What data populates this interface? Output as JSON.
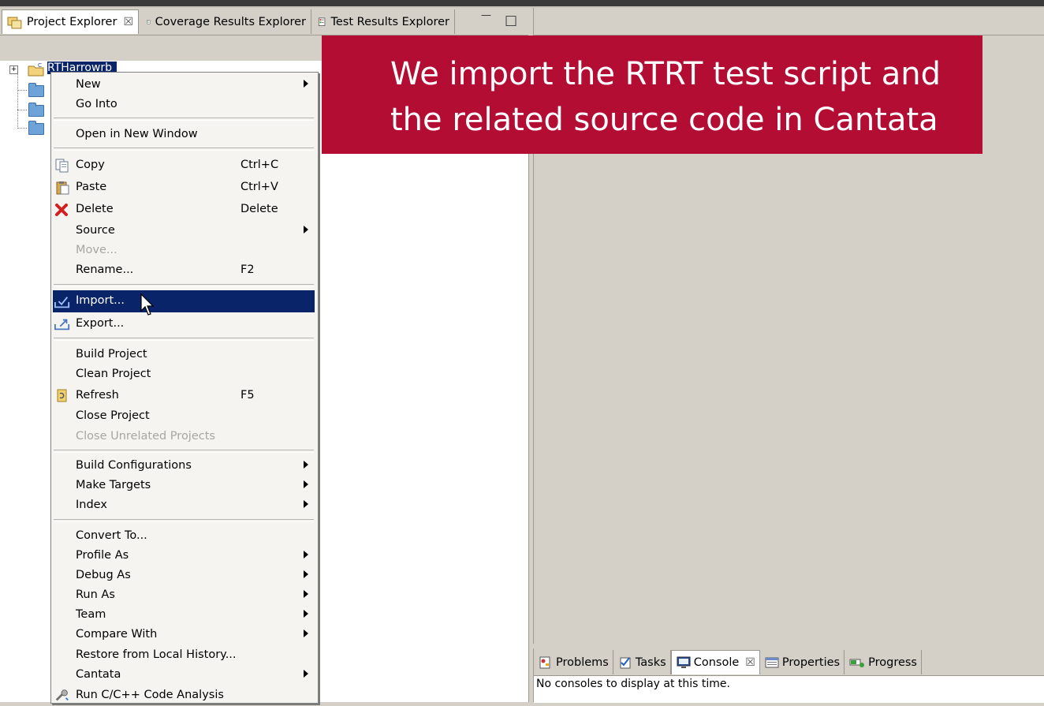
{
  "left_view": {
    "tabs": [
      {
        "label": "Project Explorer",
        "close": "☒",
        "icon": "project-explorer-icon",
        "active": true
      },
      {
        "label": "Coverage Results Explorer",
        "icon": "coverage-icon",
        "active": false
      },
      {
        "label": "Test Results Explorer",
        "icon": "test-results-icon",
        "active": false
      }
    ],
    "minimize_glyph": "—",
    "maximize_glyph": "□",
    "tree": {
      "expander": "+",
      "project_label": "RTHarrowrb"
    }
  },
  "context_menu": {
    "items": [
      {
        "label": "New",
        "submenu": true
      },
      {
        "label": "Go Into"
      },
      {
        "label": "Open in New Window"
      },
      {
        "label": "Copy",
        "shortcut": "Ctrl+C",
        "icon": "copy-icon"
      },
      {
        "label": "Paste",
        "shortcut": "Ctrl+V",
        "icon": "paste-icon"
      },
      {
        "label": "Delete",
        "shortcut": "Delete",
        "icon": "delete-icon"
      },
      {
        "label": "Source",
        "submenu": true
      },
      {
        "label": "Move...",
        "disabled": true
      },
      {
        "label": "Rename...",
        "shortcut": "F2"
      },
      {
        "label": "Import...",
        "icon": "import-icon",
        "selected": true
      },
      {
        "label": "Export...",
        "icon": "export-icon"
      },
      {
        "label": "Build Project"
      },
      {
        "label": "Clean Project"
      },
      {
        "label": "Refresh",
        "shortcut": "F5",
        "icon": "refresh-icon"
      },
      {
        "label": "Close Project"
      },
      {
        "label": "Close Unrelated Projects",
        "disabled": true
      },
      {
        "label": "Build Configurations",
        "submenu": true
      },
      {
        "label": "Make Targets",
        "submenu": true
      },
      {
        "label": "Index",
        "submenu": true
      },
      {
        "label": "Convert To..."
      },
      {
        "label": "Profile As",
        "submenu": true
      },
      {
        "label": "Debug As",
        "submenu": true
      },
      {
        "label": "Run As",
        "submenu": true
      },
      {
        "label": "Team",
        "submenu": true
      },
      {
        "label": "Compare With",
        "submenu": true
      },
      {
        "label": "Restore from Local History..."
      },
      {
        "label": "Cantata",
        "submenu": true
      },
      {
        "label": "Run C/C++ Code Analysis",
        "icon": "code-analysis-icon"
      }
    ]
  },
  "caption": {
    "line1": "We import the RTRT test script and",
    "line2": "the related source code in Cantata"
  },
  "bottom_panel": {
    "tabs": [
      {
        "label": "Problems",
        "icon": "problems-icon"
      },
      {
        "label": "Tasks",
        "icon": "tasks-icon"
      },
      {
        "label": "Console",
        "icon": "console-icon",
        "active": true,
        "close": "☒"
      },
      {
        "label": "Properties",
        "icon": "properties-icon"
      },
      {
        "label": "Progress",
        "icon": "progress-icon"
      }
    ],
    "console_message": "No consoles to display at this time."
  },
  "colors": {
    "caption_bg": "#b30d34",
    "selection": "#0a246a",
    "chrome": "#d4d0c8"
  }
}
